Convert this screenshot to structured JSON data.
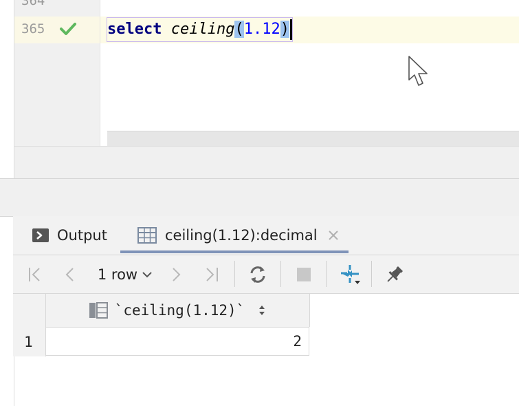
{
  "editor": {
    "lines": [
      {
        "number": "364"
      },
      {
        "number": "365",
        "status": "check-icon"
      }
    ],
    "code": {
      "keyword": "select",
      "function": "ceiling",
      "open_paren": "(",
      "argument": "1.12",
      "close_paren": ")"
    }
  },
  "tool_window": {
    "tabs": [
      {
        "label": "Output",
        "icon": "console-icon"
      },
      {
        "label": "ceiling(1.12):decimal",
        "icon": "table-icon",
        "active": true
      }
    ],
    "toolbar": {
      "row_count": "1 row"
    }
  },
  "grid": {
    "column_header": "`ceiling(1.12)`",
    "rows": [
      {
        "num": "1",
        "value": "2"
      }
    ]
  },
  "colors": {
    "keyword": "#000080",
    "number": "#0000ff",
    "paren_highlight": "#9dc3ef",
    "current_line": "#fdfbe6",
    "check": "#5fb85f",
    "accent_blue": "#3592c4"
  }
}
